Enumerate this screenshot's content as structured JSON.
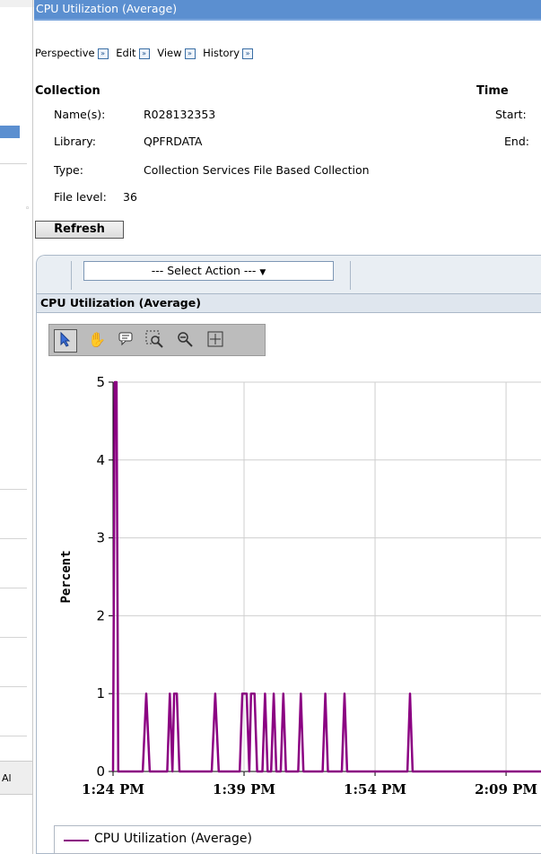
{
  "window": {
    "title": "CPU Utilization (Average)"
  },
  "left_pane": {
    "column_header_fragment": "Al"
  },
  "menu": {
    "items": [
      "Perspective",
      "Edit",
      "View",
      "History"
    ]
  },
  "collection": {
    "heading": "Collection",
    "names_label": "Name(s):",
    "names_value": "R028132353",
    "library_label": "Library:",
    "library_value": "QPFRDATA",
    "type_label": "Type:",
    "type_value": "Collection Services File Based Collection",
    "file_level_label": "File level:",
    "file_level_value": "36"
  },
  "time": {
    "heading": "Time",
    "start_label": "Start:",
    "end_label": "End:"
  },
  "refresh_label": "Refresh",
  "panel": {
    "select_action": "--- Select Action ---",
    "chart_title": "CPU Utilization (Average)"
  },
  "tools": [
    "select-arrow-icon",
    "hand-pan-icon",
    "comment-icon",
    "zoom-box-icon",
    "zoom-out-icon",
    "move-crosshair-icon"
  ],
  "legend": {
    "label": "CPU Utilization (Average)",
    "color": "#8b0082"
  },
  "chart_data": {
    "type": "line",
    "ylabel": "Percent",
    "ylim": [
      0,
      5
    ],
    "yticks": [
      0,
      1,
      2,
      3,
      4,
      5
    ],
    "xticks": [
      "1:24 PM",
      "1:39 PM",
      "1:54 PM",
      "2:09 PM"
    ],
    "xtick_minutes": [
      0,
      15,
      30,
      45
    ],
    "xlim_minutes": [
      0,
      49
    ],
    "series": [
      {
        "name": "CPU Utilization (Average)",
        "color": "#8b0082",
        "points": [
          [
            0,
            0
          ],
          [
            0.2,
            5
          ],
          [
            0.4,
            5
          ],
          [
            0.6,
            0
          ],
          [
            3.4,
            0
          ],
          [
            3.8,
            1
          ],
          [
            4.2,
            0
          ],
          [
            6.2,
            0
          ],
          [
            6.5,
            1
          ],
          [
            6.8,
            0
          ],
          [
            7.0,
            1
          ],
          [
            7.3,
            1
          ],
          [
            7.6,
            0
          ],
          [
            11.3,
            0
          ],
          [
            11.7,
            1
          ],
          [
            12.1,
            0
          ],
          [
            14.5,
            0
          ],
          [
            14.8,
            1
          ],
          [
            15.3,
            1
          ],
          [
            15.6,
            0
          ],
          [
            15.8,
            1
          ],
          [
            16.2,
            1
          ],
          [
            16.5,
            0
          ],
          [
            17.1,
            0
          ],
          [
            17.4,
            1
          ],
          [
            17.7,
            0
          ],
          [
            18.1,
            0
          ],
          [
            18.4,
            1
          ],
          [
            18.7,
            0
          ],
          [
            19.2,
            0
          ],
          [
            19.5,
            1
          ],
          [
            19.8,
            0
          ],
          [
            21.2,
            0
          ],
          [
            21.5,
            1
          ],
          [
            21.8,
            0
          ],
          [
            24.0,
            0
          ],
          [
            24.3,
            1
          ],
          [
            24.6,
            0
          ],
          [
            26.2,
            0
          ],
          [
            26.5,
            1
          ],
          [
            26.8,
            0
          ],
          [
            33.7,
            0
          ],
          [
            34.0,
            1
          ],
          [
            34.3,
            0
          ],
          [
            49,
            0
          ]
        ]
      }
    ]
  }
}
